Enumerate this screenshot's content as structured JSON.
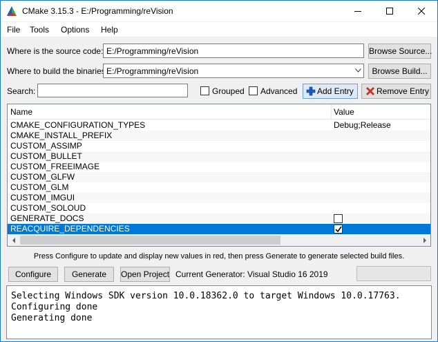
{
  "window": {
    "title": "CMake 3.15.3 - E:/Programming/reVision"
  },
  "menu": [
    "File",
    "Tools",
    "Options",
    "Help"
  ],
  "source": {
    "label": "Where is the source code:",
    "value": "E:/Programming/reVision",
    "browse_label": "Browse Source..."
  },
  "build": {
    "label": "Where to build the binaries:",
    "value": "E:/Programming/reVision",
    "browse_label": "Browse Build..."
  },
  "search": {
    "label": "Search:",
    "value": "",
    "grouped_label": "Grouped",
    "grouped_checked": false,
    "advanced_label": "Advanced",
    "advanced_checked": false,
    "add_entry_label": "Add Entry",
    "remove_entry_label": "Remove Entry"
  },
  "table": {
    "columns": [
      "Name",
      "Value"
    ],
    "rows": [
      {
        "name": "CMAKE_CONFIGURATION_TYPES",
        "value": "Debug;Release"
      },
      {
        "name": "CMAKE_INSTALL_PREFIX",
        "value": ""
      },
      {
        "name": "CUSTOM_ASSIMP",
        "value": ""
      },
      {
        "name": "CUSTOM_BULLET",
        "value": ""
      },
      {
        "name": "CUSTOM_FREEIMAGE",
        "value": ""
      },
      {
        "name": "CUSTOM_GLFW",
        "value": ""
      },
      {
        "name": "CUSTOM_GLM",
        "value": ""
      },
      {
        "name": "CUSTOM_IMGUI",
        "value": ""
      },
      {
        "name": "CUSTOM_SOLOUD",
        "value": ""
      },
      {
        "name": "GENERATE_DOCS",
        "value": "",
        "checkbox": true,
        "checked": false
      },
      {
        "name": "REACQUIRE_DEPENDENCIES",
        "value": "",
        "checkbox": true,
        "checked": true,
        "selected": true
      }
    ]
  },
  "hint": "Press Configure to update and display new values in red, then press Generate to generate selected build files.",
  "actions": {
    "configure_label": "Configure",
    "generate_label": "Generate",
    "open_project_label": "Open Project",
    "generator_text": "Current Generator: Visual Studio 16 2019"
  },
  "output": [
    "Selecting Windows SDK version 10.0.18362.0 to target Windows 10.0.17763.",
    "Configuring done",
    "Generating done"
  ],
  "colors": {
    "selection": "#0078d7",
    "window_border": "#1979ca"
  }
}
